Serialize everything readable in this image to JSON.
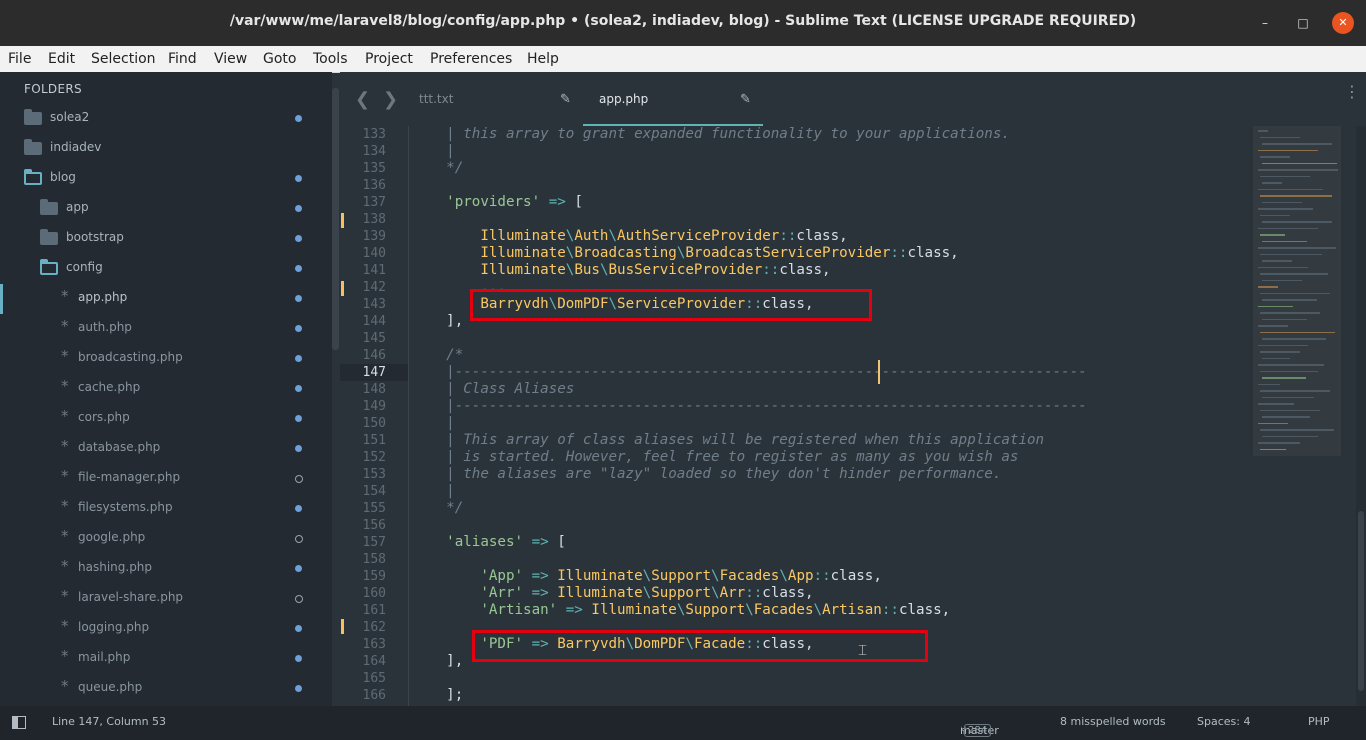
{
  "window": {
    "title": "/var/www/me/laravel8/blog/config/app.php • (solea2, indiadev, blog) - Sublime Text (LICENSE UPGRADE REQUIRED)",
    "minimize": "–",
    "maximize": "□",
    "close": "✕"
  },
  "menu": [
    "File",
    "Edit",
    "Selection",
    "Find",
    "View",
    "Goto",
    "Tools",
    "Project",
    "Preferences",
    "Help"
  ],
  "sidebar": {
    "header": "FOLDERS",
    "items": [
      {
        "label": "solea2",
        "kind": "folder",
        "status": "dot"
      },
      {
        "label": "indiadev",
        "kind": "folder",
        "status": "none"
      },
      {
        "label": "blog",
        "kind": "folder-open",
        "status": "dot"
      },
      {
        "label": "app",
        "kind": "folder",
        "status": "dot"
      },
      {
        "label": "bootstrap",
        "kind": "folder",
        "status": "dot"
      },
      {
        "label": "config",
        "kind": "folder-open",
        "status": "dot"
      },
      {
        "label": "app.php",
        "kind": "file",
        "status": "dot",
        "active": true
      },
      {
        "label": "auth.php",
        "kind": "file",
        "status": "dot"
      },
      {
        "label": "broadcasting.php",
        "kind": "file",
        "status": "dot"
      },
      {
        "label": "cache.php",
        "kind": "file",
        "status": "dot"
      },
      {
        "label": "cors.php",
        "kind": "file",
        "status": "dot"
      },
      {
        "label": "database.php",
        "kind": "file",
        "status": "dot"
      },
      {
        "label": "file-manager.php",
        "kind": "file",
        "status": "hollow"
      },
      {
        "label": "filesystems.php",
        "kind": "file",
        "status": "dot"
      },
      {
        "label": "google.php",
        "kind": "file",
        "status": "hollow"
      },
      {
        "label": "hashing.php",
        "kind": "file",
        "status": "dot"
      },
      {
        "label": "laravel-share.php",
        "kind": "file",
        "status": "hollow"
      },
      {
        "label": "logging.php",
        "kind": "file",
        "status": "dot"
      },
      {
        "label": "mail.php",
        "kind": "file",
        "status": "dot"
      },
      {
        "label": "queue.php",
        "kind": "file",
        "status": "dot"
      }
    ]
  },
  "tabs": [
    {
      "label": "ttt.txt",
      "active": false
    },
    {
      "label": "app.php",
      "active": true
    }
  ],
  "nav": {
    "back": "❮",
    "forward": "❯",
    "more": "⋮"
  },
  "editor": {
    "current_line": "147",
    "lines": [
      {
        "n": "133",
        "html": "<span class='cm'>| this array to grant expanded functionality to your applications.</span>"
      },
      {
        "n": "134",
        "html": "<span class='cm'>|</span>"
      },
      {
        "n": "135",
        "html": "<span class='cm'>*/</span>"
      },
      {
        "n": "136",
        "html": ""
      },
      {
        "n": "137",
        "html": "<span class='str'>'providers'</span> <span class='op'>=&gt;</span> ["
      },
      {
        "n": "138",
        "html": ""
      },
      {
        "n": "139",
        "html": "    <span class='cls'>Illuminate</span><span class='op'>\\</span><span class='cls'>Auth</span><span class='op'>\\</span><span class='cls'>AuthServiceProvider</span><span class='op'>::</span>class,"
      },
      {
        "n": "140",
        "html": "    <span class='cls'>Illuminate</span><span class='op'>\\</span><span class='cls'>Broadcasting</span><span class='op'>\\</span><span class='cls'>BroadcastServiceProvider</span><span class='op'>::</span>class,"
      },
      {
        "n": "141",
        "html": "    <span class='cls'>Illuminate</span><span class='op'>\\</span><span class='cls'>Bus</span><span class='op'>\\</span><span class='cls'>BusServiceProvider</span><span class='op'>::</span>class,"
      },
      {
        "n": "142",
        "html": "    ..."
      },
      {
        "n": "143",
        "html": "    <span class='cls'>Barryvdh</span><span class='op'>\\</span><span class='cls'>DomPDF</span><span class='op'>\\</span><span class='cls'>ServiceProvider</span><span class='op'>::</span>class,"
      },
      {
        "n": "144",
        "html": "],"
      },
      {
        "n": "145",
        "html": ""
      },
      {
        "n": "146",
        "html": "<span class='cm'>/*</span>"
      },
      {
        "n": "147",
        "html": "<span class='cm'>|--------------------------------------------------------------------------</span>"
      },
      {
        "n": "148",
        "html": "<span class='cm'>| Class Aliases</span>"
      },
      {
        "n": "149",
        "html": "<span class='cm'>|--------------------------------------------------------------------------</span>"
      },
      {
        "n": "150",
        "html": "<span class='cm'>|</span>"
      },
      {
        "n": "151",
        "html": "<span class='cm'>| This array of class aliases will be registered when this application</span>"
      },
      {
        "n": "152",
        "html": "<span class='cm'>| is started. However, feel free to register as many as you wish as</span>"
      },
      {
        "n": "153",
        "html": "<span class='cm'>| the aliases are \"lazy\" loaded so they don't hinder performance.</span>"
      },
      {
        "n": "154",
        "html": "<span class='cm'>|</span>"
      },
      {
        "n": "155",
        "html": "<span class='cm'>*/</span>"
      },
      {
        "n": "156",
        "html": ""
      },
      {
        "n": "157",
        "html": "<span class='str'>'aliases'</span> <span class='op'>=&gt;</span> ["
      },
      {
        "n": "158",
        "html": ""
      },
      {
        "n": "159",
        "html": "    <span class='str'>'App'</span> <span class='op'>=&gt;</span> <span class='cls'>Illuminate</span><span class='op'>\\</span><span class='cls'>Support</span><span class='op'>\\</span><span class='cls'>Facades</span><span class='op'>\\</span><span class='cls'>App</span><span class='op'>::</span>class,"
      },
      {
        "n": "160",
        "html": "    <span class='str'>'Arr'</span> <span class='op'>=&gt;</span> <span class='cls'>Illuminate</span><span class='op'>\\</span><span class='cls'>Support</span><span class='op'>\\</span><span class='cls'>Arr</span><span class='op'>::</span>class,"
      },
      {
        "n": "161",
        "html": "    <span class='str'>'Artisan'</span> <span class='op'>=&gt;</span> <span class='cls'>Illuminate</span><span class='op'>\\</span><span class='cls'>Support</span><span class='op'>\\</span><span class='cls'>Facades</span><span class='op'>\\</span><span class='cls'>Artisan</span><span class='op'>::</span>class,"
      },
      {
        "n": "162",
        "html": ""
      },
      {
        "n": "163",
        "html": "    <span class='str'>'PDF'</span> <span class='op'>=&gt;</span> <span class='cls'>Barryvdh</span><span class='op'>\\</span><span class='cls'>DomPDF</span><span class='op'>\\</span><span class='cls'>Facade</span><span class='op'>::</span>class,"
      },
      {
        "n": "164",
        "html": "],"
      },
      {
        "n": "165",
        "html": ""
      },
      {
        "n": "166",
        "html": "<span class='sq'>];</span>"
      }
    ]
  },
  "status": {
    "position": "Line 147, Column 53",
    "branch": "master",
    "branch_count": "284",
    "spelling": "8 misspelled words",
    "indent": "Spaces: 4",
    "syntax": "PHP"
  },
  "colors": {
    "accent": "#5fb3b3",
    "highlight_box": "#e3000f",
    "sidebar_bg": "#232a31",
    "editor_bg": "#2b333a"
  }
}
